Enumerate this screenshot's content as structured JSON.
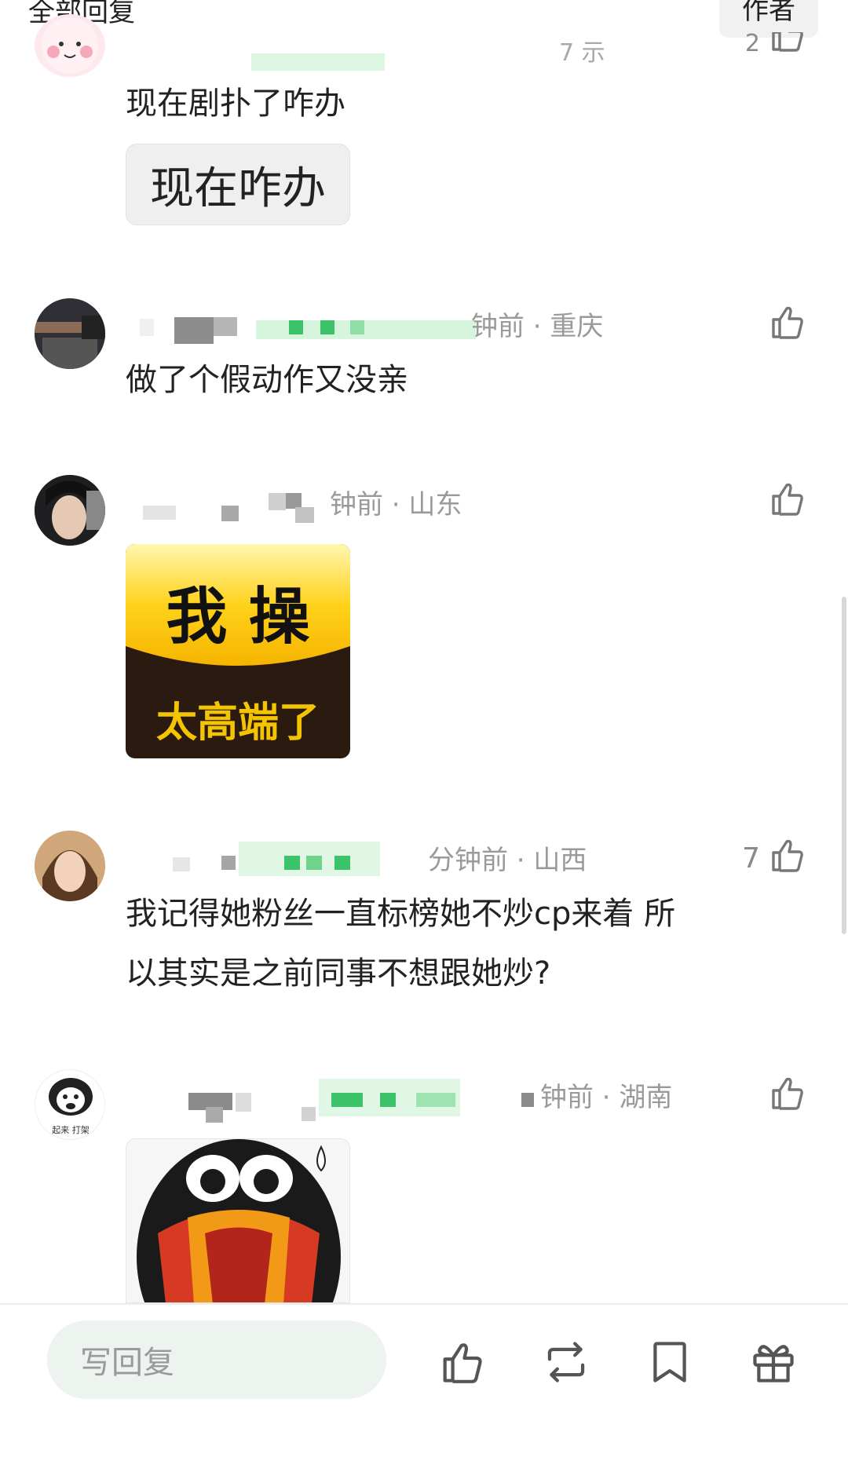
{
  "header": {
    "title": "全部回复",
    "author_tab": "作者"
  },
  "comments": [
    {
      "meta_tail": "7 示",
      "like_count": "2",
      "text": "现在剧扑了咋办",
      "sticker_text": "现在咋办"
    },
    {
      "meta_tail": "钟前 · 重庆",
      "like_count": "",
      "text": "做了个假动作又没亲"
    },
    {
      "meta_tail": "钟前 · 山东",
      "like_count": "",
      "sticker": {
        "line1": "我 操",
        "line2": "太高端了"
      }
    },
    {
      "meta_tail": "分钟前 · 山西",
      "like_count": "7",
      "text_line1": "我记得她粉丝一直标榜她不炒cp来着  所",
      "text_line2": "以其实是之前同事不想跟她炒?"
    },
    {
      "meta_tail": "钟前 · 湖南",
      "like_count": "",
      "avatar_caption": "起来 打架"
    }
  ],
  "bottom_bar": {
    "reply_placeholder": "写回复"
  },
  "colors": {
    "accent_green": "#3cc36a",
    "mosaic_green": "#d6f5dd",
    "text": "#222222",
    "meta": "#9a9a9a"
  },
  "icons": [
    "thumbs-up-icon",
    "repost-icon",
    "bookmark-icon",
    "gift-icon"
  ]
}
